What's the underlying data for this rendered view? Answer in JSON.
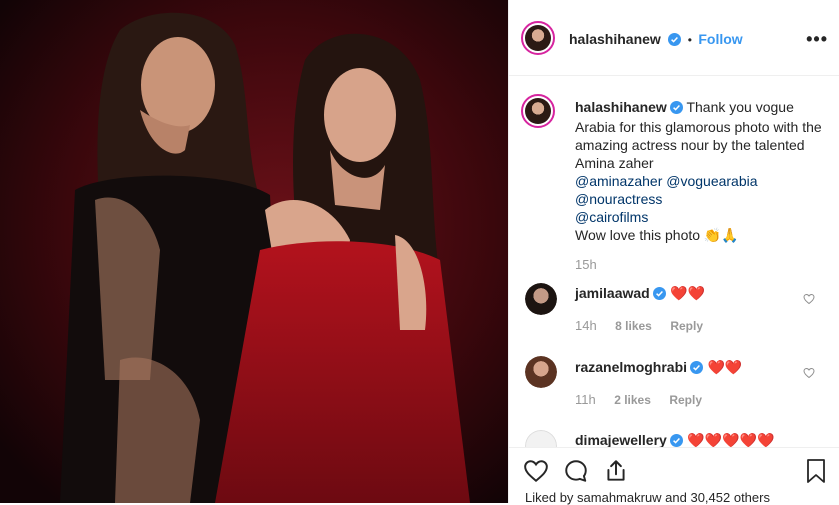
{
  "post": {
    "username": "halashihanew",
    "follow_label": "Follow",
    "dot_separator": "•",
    "more_icon": "more-options-icon",
    "image_alt": "Two women posing in black and red dresses"
  },
  "caption": {
    "username": "halashihanew",
    "text": "Thank you vogue Arabia for this glamorous photo with the amazing actress nour by the talented Amina zaher",
    "mentions": [
      "@aminazaher @voguearabia",
      "@nouractress",
      "@cairofilms"
    ],
    "closing": "Wow love this photo 👏🙏",
    "time": "15h"
  },
  "comments": [
    {
      "username": "jamilaawad",
      "text": "❤️❤️",
      "time": "14h",
      "likes": "8 likes",
      "reply": "Reply"
    },
    {
      "username": "razanelmoghrabi",
      "text": "❤️❤️",
      "time": "11h",
      "likes": "2 likes",
      "reply": "Reply"
    },
    {
      "username": "dimajewellery",
      "text": "❤️❤️❤️❤️❤️"
    }
  ],
  "likes_line": "Liked by samahmakruw and 30,452 others",
  "colors": {
    "follow": "#3897f0",
    "mention": "#003569",
    "heart": "#ed4956",
    "verified": "#3897f0"
  }
}
